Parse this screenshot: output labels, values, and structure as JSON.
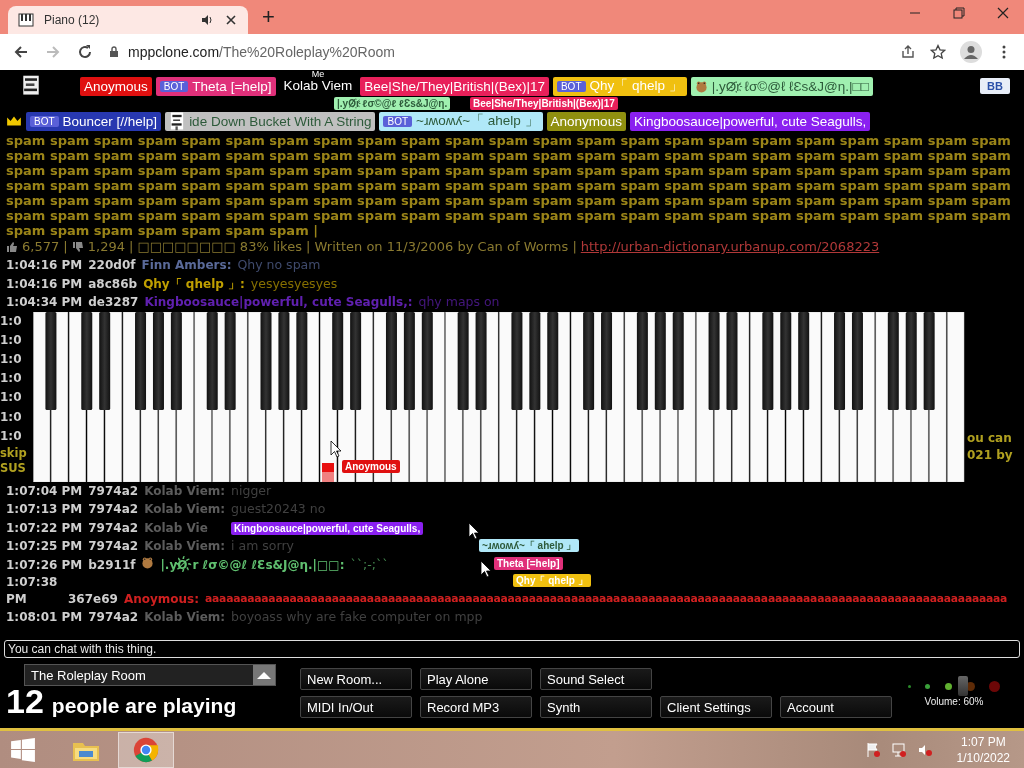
{
  "browser": {
    "tab_title": "Piano (12)",
    "new_tab": "+",
    "url_host": "mppclone.com",
    "url_path": "/The%20Roleplay%20Room"
  },
  "users": {
    "row_1": [
      {
        "kind": "plain",
        "name": "Anoymous",
        "color": "#e01010"
      },
      {
        "kind": "plain",
        "badge": "BOT",
        "name": "Theta [=help]",
        "color": "#e0307a"
      },
      {
        "kind": "plain",
        "name": "Kolab Viem",
        "me_label": "Me",
        "color": "#000000"
      },
      {
        "kind": "plain",
        "name": "Bee|She/They|British|(Bex)|17",
        "color": "#e8205a"
      },
      {
        "kind": "plain",
        "badge": "BOT",
        "name": "Qhy「 qhelp 」",
        "color": "#f0c010"
      },
      {
        "kind": "frog",
        "name": "|.yØ҉r ℓσ©@ℓ ℓƐs&J@η.|□□",
        "color": "#a0f0b0"
      }
    ],
    "row_2": [
      {
        "kind": "plain",
        "badge": "BOT",
        "name": "Bouncer [//help]",
        "color": "#2838b0"
      },
      {
        "kind": "glitch",
        "name": "ide Down Bucket With A String",
        "color": "#c0c0c0"
      },
      {
        "kind": "plain",
        "badge": "BOT",
        "name": "~ɹʍoʍʎ~「 ahelp 」",
        "color": "#b0e8f8"
      },
      {
        "kind": "plain",
        "name": "Anonymous",
        "color": "#909010"
      },
      {
        "kind": "plain",
        "name": "Kingboosauce|powerful, cute Seagulls,",
        "color": "#8a20f0"
      }
    ]
  },
  "bb_button": "BB",
  "spam_message": "spam spam spam spam spam spam spam spam spam spam spam spam spam spam spam spam spam spam spam spam spam spam spam spam spam spam spam spam spam spam spam spam spam spam spam spam spam spam spam spam spam spam spam spam spam spam spam spam spam spam spam spam spam spam spam spam spam spam spam spam spam spam spam spam spam spam spam spam spam spam spam spam spam spam spam spam spam spam spam spam spam spam spam spam spam spam spam spam spam spam spam spam spam spam spam spam spam spam spam spam spam spam spam spam spam spam spam spam spam spam spam spam spam spam spam spam spam spam spam spam spam spam spam spam spam spam spam spam spam spam spam spam spam spam spam spam spam spam spam spam spam spam spam spam spam |",
  "stats": {
    "likes": "6,577 |",
    "dislikes": "1,294 |",
    "rest": "□□□□□□□□ 83% likes | Written on 11/3/2006 by Can of Worms |",
    "link": "http://urban-dictionary.urbanup.com/2068223"
  },
  "chat_before": [
    {
      "time": "1:04:16 PM",
      "id": "220d0f",
      "name": "Finn Ambers:",
      "color": "#5a6a9a",
      "message": "Qhy no spam"
    },
    {
      "time": "1:04:16 PM",
      "id": "a8c86b",
      "name": "Qhy「 qhelp 」:",
      "color": "#c0a000",
      "message": "yesyesyesyes"
    },
    {
      "time": "1:04:34 PM",
      "id": "de3287",
      "name": "Kingboosauce|powerful, cute Seagulls,:",
      "color": "#6020b0",
      "message": "qhy maps on"
    }
  ],
  "hidden_left": [
    "1:0",
    "1:0",
    "1:0",
    "1:0",
    "1:0",
    "1:0",
    "1:0",
    "skip",
    "SUS"
  ],
  "hidden_right": [
    "ou can",
    "021 by"
  ],
  "chat_after": [
    {
      "wrapped": false,
      "time": "1:07:04 PM",
      "id": "7974a2",
      "name": "Kolab Viem:",
      "color": "#5c5c5c",
      "message": "nigger"
    },
    {
      "wrapped": false,
      "time": "1:07:13 PM",
      "id": "7974a2",
      "name": "Kolab Viem:",
      "color": "#5c5c5c",
      "message": "guest20243 no"
    },
    {
      "wrapped": false,
      "time": "1:07:22 PM",
      "id": "7974a2",
      "name": "Kolab Vie",
      "color": "#5c5c5c"
    },
    {
      "wrapped": false,
      "time": "1:07:25 PM",
      "id": "7974a2",
      "name": "Kolab Viem:",
      "color": "#5c5c5c",
      "message": "i am sorry"
    },
    {
      "wrapped": false,
      "time": "1:07:26 PM",
      "id": "b2911f",
      "name": "|.yØ҉r ℓσ©@ℓ ℓƐs&J@η.|□□:",
      "color": "#60c070",
      "message": "``;-;``"
    },
    {
      "wrapped": true,
      "time": "1:07:38 PM",
      "id": "367e69",
      "name": "Anoymous:",
      "color": "#d02020",
      "message": "aaaaaaaaaaaaaaaaaaaaaaaaaaaaaaaaaaaaaaaaaaaaaaaaaaaaaaaaaaaaaaaaaaaaaaaaaaaaaaaaaaaaaaaaaaaaaaaaaaaaaaaaaaaaaaaaaa"
    },
    {
      "wrapped": false,
      "time": "1:08:01 PM",
      "id": "7974a2",
      "name": "Kolab Viem:",
      "color": "#5c5c5c",
      "message": "boyoass why are fake computer on mpp"
    }
  ],
  "cursor_labels": [
    {
      "label": "|.yØ҉r ℓσ©@ℓ ℓƐs&J@η.",
      "color": "#a0f0b0"
    },
    {
      "label": "Bee|She/They|British|(Bex)|17",
      "color": "#e8205a"
    },
    {
      "label": "Anoymous",
      "color": "#e01010"
    },
    {
      "label": "Kingboosauce|powerful, cute Seagulls,",
      "color": "#8a20f0"
    },
    {
      "label": "~ɹʍoʍʎ~「 ahelp 」",
      "color": "#b0e8f8"
    },
    {
      "label": "Theta [=help]",
      "color": "#e0307a"
    },
    {
      "label": "Qhy「 qhelp 」",
      "color": "#f0c010"
    }
  ],
  "chat_input": {
    "placeholder": "You can chat with this thing."
  },
  "room_select": {
    "value": "The Roleplay Room"
  },
  "player_count": "12",
  "player_label": "people are playing",
  "buttons": [
    [
      "New Room...",
      "Play Alone",
      "Sound Select"
    ],
    [
      "MIDI In/Out",
      "Record MP3",
      "Synth",
      "Client Settings",
      "Account"
    ]
  ],
  "volume": {
    "level": 0.6,
    "label": "Volume: 60%"
  },
  "taskbar": {
    "apps": [
      {
        "kind": "explorer",
        "selected": false
      },
      {
        "kind": "chrome",
        "selected": true
      }
    ],
    "time": "1:07 PM",
    "date": "1/10/2022"
  }
}
